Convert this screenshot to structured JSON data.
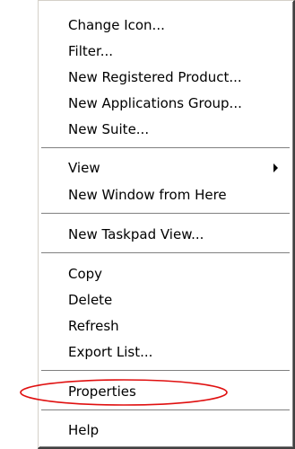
{
  "context_menu": {
    "items": [
      {
        "label": "Change Icon..."
      },
      {
        "label": "Filter..."
      },
      {
        "label": "New Registered Product..."
      },
      {
        "label": "New Applications Group..."
      },
      {
        "label": "New Suite..."
      },
      {
        "label": "View",
        "has_submenu": true
      },
      {
        "label": "New Window from Here"
      },
      {
        "label": "New Taskpad View..."
      },
      {
        "label": "Copy"
      },
      {
        "label": "Delete"
      },
      {
        "label": "Refresh"
      },
      {
        "label": "Export List..."
      },
      {
        "label": "Properties",
        "annotated": true
      },
      {
        "label": "Help"
      }
    ]
  },
  "annotation": {
    "color": "#e01010",
    "shape": "ellipse"
  }
}
